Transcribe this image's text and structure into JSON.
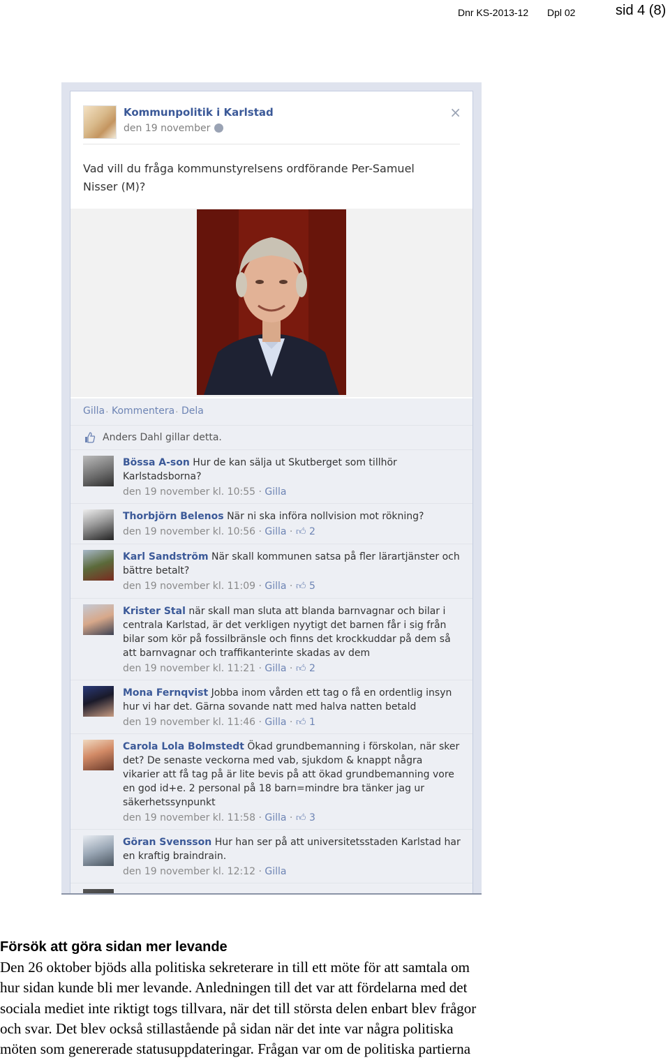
{
  "header": {
    "dnr": "Dnr KS-2013-12",
    "dpl": "Dpl 02",
    "page": "sid 4 (8)"
  },
  "fb_post": {
    "page_name": "Kommunpolitik i Karlstad",
    "date": "den 19 november",
    "close_symbol": "×",
    "text": "Vad vill du fråga kommunstyrelsens ordförande Per-Samuel Nisser (M)?",
    "actions": [
      "Gilla",
      "Kommentera",
      "Dela"
    ],
    "likes": "Anders Dahl gillar detta.",
    "comments": [
      {
        "author": "Bössa A-son",
        "text": "Hur de kan sälja ut Skutberget som tillhör Karlstadsborna?",
        "meta": "den 19 november kl. 10:55",
        "gilla": "Gilla",
        "likes": ""
      },
      {
        "author": "Thorbjörn Belenos",
        "text": "När ni ska införa nollvision mot rökning?",
        "meta": "den 19 november kl. 10:56",
        "gilla": "Gilla",
        "likes": "2"
      },
      {
        "author": "Karl Sandström",
        "text": "När skall kommunen satsa på fler lärartjänster och bättre betalt?",
        "meta": "den 19 november kl. 11:09",
        "gilla": "Gilla",
        "likes": "5"
      },
      {
        "author": "Krister Stal",
        "text": "när skall man sluta att blanda barnvagnar och bilar i centrala Karlstad, är det verkligen nyytigt det barnen får i sig från bilar som kör på fossilbränsle och finns det krockkuddar på dem så att barnvagnar och traffikanterinte skadas av dem",
        "meta": "den 19 november kl. 11:21",
        "gilla": "Gilla",
        "likes": "2"
      },
      {
        "author": "Mona Fernqvist",
        "text": "Jobba inom vården ett tag o få en ordentlig insyn hur vi har det. Gärna sovande natt med halva natten betald",
        "meta": "den 19 november kl. 11:46",
        "gilla": "Gilla",
        "likes": "1"
      },
      {
        "author": "Carola Lola Bolmstedt",
        "text": "Ökad grundbemanning i förskolan, när sker det? De senaste veckorna med vab, sjukdom & knappt några vikarier att få tag på är lite bevis på att ökad grundbemanning vore en god id+e. 2 personal på 18 barn=mindre bra tänker jag ur säkerhetssynpunkt",
        "meta": "den 19 november kl. 11:58",
        "gilla": "Gilla",
        "likes": "3"
      },
      {
        "author": "Göran Svensson",
        "text": "Hur han ser på att universitetsstaden Karlstad har en kraftig braindrain.",
        "meta": "den 19 november kl. 12:12",
        "gilla": "Gilla",
        "likes": ""
      }
    ]
  },
  "section": {
    "heading": "Försök att göra sidan mer levande",
    "lines": [
      "Den 26 oktober bjöds alla politiska sekreterare in till ett möte för att samtala om",
      "hur sidan kunde bli mer levande.  Anledningen till det var att fördelarna med det",
      "sociala mediet inte riktigt togs tillvara, när det till största delen enbart blev frågor",
      "och svar. Det blev också stillastående på sidan när det inte var några politiska",
      "möten som genererade statusuppdateringar. Frågan var om de politiska partierna"
    ]
  }
}
